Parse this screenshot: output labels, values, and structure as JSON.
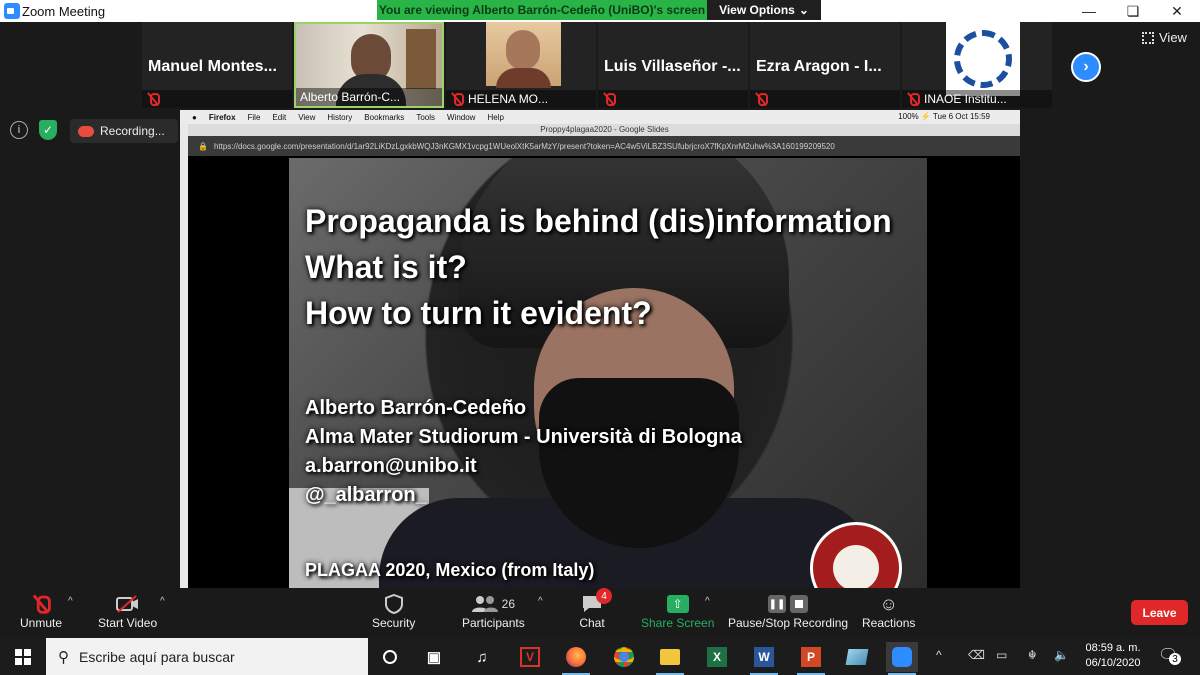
{
  "window": {
    "title": "Zoom Meeting"
  },
  "share_banner": {
    "text": "You are viewing Alberto Barrón-Cedeño (UniBO)'s screen",
    "view_options": "View Options"
  },
  "participants": [
    {
      "name": "Manuel  Montes..."
    },
    {
      "name": "Alberto Barrón-C..."
    },
    {
      "name": "HELENA MO..."
    },
    {
      "name": "Luis Villaseñor -..."
    },
    {
      "name": "Ezra Aragon - I..."
    },
    {
      "name": "INAOE Institu..."
    }
  ],
  "view_button": "View",
  "recording": {
    "label": "Recording..."
  },
  "shared_screen": {
    "menubar": [
      "Firefox",
      "File",
      "Edit",
      "View",
      "History",
      "Bookmarks",
      "Tools",
      "Window",
      "Help"
    ],
    "menubar_right": "100% ⚡ Tue 6 Oct 15:59",
    "tab_title": "Proppy4plagaa2020 - Google Slides",
    "url": "https://docs.google.com/presentation/d/1ar92LiKDzLgxkbWQJ3nKGMX1vcpg1WUeolXtK5arMzY/present?token=AC4w5ViLBZ3SUfubrjcroX7fKpXnrM2uhw%3A160199209520"
  },
  "slide": {
    "title_lines": [
      "Propaganda is behind (dis)information",
      "What is it?",
      "How to turn it evident?"
    ],
    "author_lines": [
      "Alberto Barrón-Cedeño",
      "Alma Mater Studiorum - Università di Bologna",
      "a.barron@unibo.it",
      "@_albarron_"
    ],
    "footer": "PLAGAA 2020, Mexico (from Italy)"
  },
  "controls": {
    "unmute": "Unmute",
    "start_video": "Start Video",
    "security": "Security",
    "participants": "Participants",
    "participants_count": "26",
    "chat": "Chat",
    "chat_badge": "4",
    "share_screen": "Share Screen",
    "record": "Pause/Stop Recording",
    "reactions": "Reactions",
    "leave": "Leave"
  },
  "taskbar": {
    "search_placeholder": "Escribe aquí para buscar",
    "time": "08:59 a. m.",
    "date": "06/10/2020",
    "notifications": "3"
  }
}
